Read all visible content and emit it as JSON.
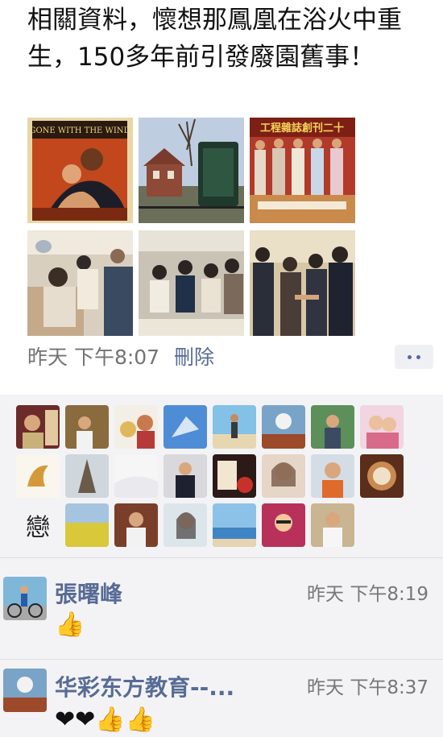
{
  "post": {
    "text": "相關資料，懷想那鳳凰在浴火中重生，150多年前引發廢園舊事！",
    "time": "昨天 下午8:07",
    "delete_label": "刪除"
  },
  "photos": [
    {
      "name": "gone-with-the-wind-poster",
      "caption": "GONE WITH THE WIND"
    },
    {
      "name": "historic-house-photo",
      "caption": ""
    },
    {
      "name": "magazine-anniversary-photo",
      "caption": "工程雜誌創刊二十"
    },
    {
      "name": "airplane-cabin-photo",
      "caption": ""
    },
    {
      "name": "airplane-passengers-photo",
      "caption": ""
    },
    {
      "name": "handshake-photo",
      "caption": ""
    }
  ],
  "like_avatars": 24,
  "comments": [
    {
      "name": "張曙峰",
      "time": "昨天 下午8:19",
      "reaction": "👍"
    },
    {
      "name": "华彩东方教育--...",
      "time": "昨天 下午8:37",
      "reaction": "❤❤👍👍"
    }
  ],
  "colors": {
    "link": "#576b95",
    "meta": "#737373",
    "panel": "#f3f3f5"
  }
}
